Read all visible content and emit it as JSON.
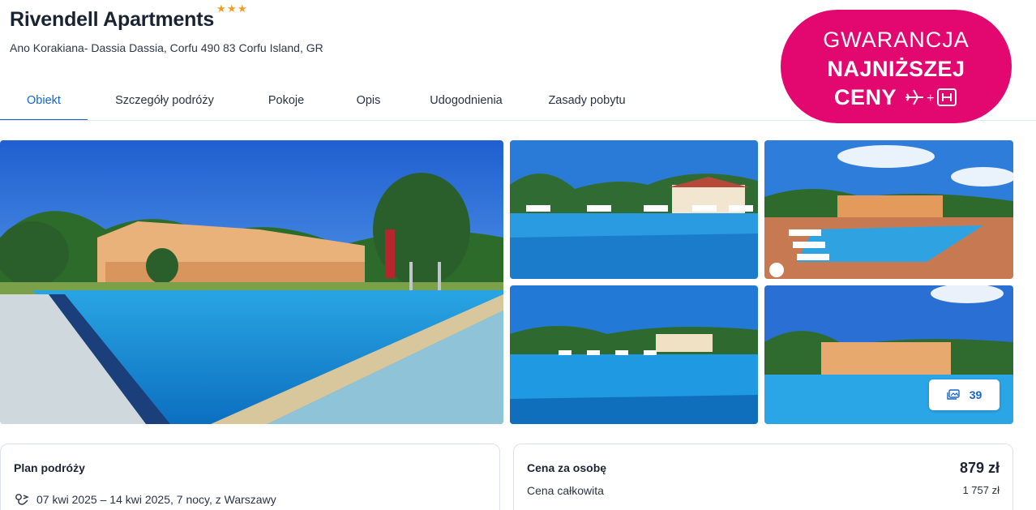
{
  "hotel": {
    "name": "Rivendell Apartments",
    "stars": 3,
    "star_glyph": "★",
    "address": "Ano Korakiana- Dassia Dassia, Corfu 490 83 Corfu Island, GR"
  },
  "tabs": [
    {
      "label": "Obiekt",
      "active": true
    },
    {
      "label": "Szczegóły podróży",
      "active": false
    },
    {
      "label": "Pokoje",
      "active": false
    },
    {
      "label": "Opis",
      "active": false
    },
    {
      "label": "Udogodnienia",
      "active": false
    },
    {
      "label": "Zasady pobytu",
      "active": false
    }
  ],
  "badge": {
    "line1": "GWARANCJA",
    "line2": "NAJNIŻSZEJ",
    "line3": "CENY",
    "icons": [
      "plane-icon",
      "plus-icon",
      "hotel-h-icon"
    ],
    "color": "#e2086f"
  },
  "gallery": {
    "photo_count": "39",
    "photos": [
      "pool-and-apartments-main-photo",
      "pool-with-sunbeds-photo",
      "pool-aerial-photo",
      "pool-reflection-photo",
      "pool-and-apartments-photo"
    ]
  },
  "plan": {
    "title": "Plan podróży",
    "dates": "07 kwi 2025 – 14 kwi 2025, 7 nocy, z Warszawy"
  },
  "price": {
    "per_person_label": "Cena za osobę",
    "per_person_value": "879 zł",
    "total_label": "Cena całkowita",
    "total_value": "1 757 zł"
  },
  "colors": {
    "accent": "#1466c9",
    "star": "#f39a1f",
    "text": "#1c2433"
  }
}
